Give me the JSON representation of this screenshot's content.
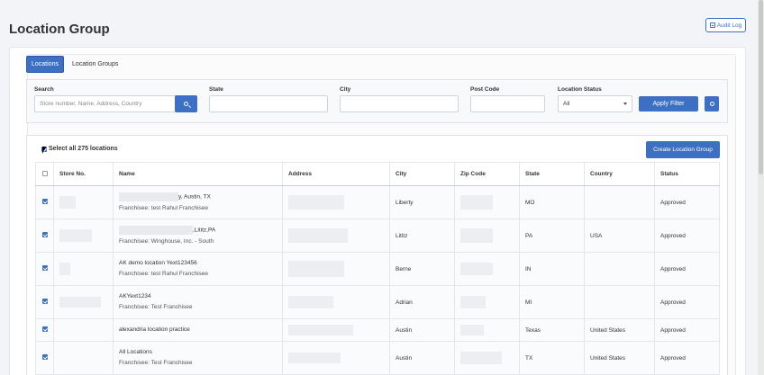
{
  "page": {
    "title": "Location Group",
    "audit_log_label": "Audit Log"
  },
  "tabs": [
    {
      "label": "Locations",
      "active": true
    },
    {
      "label": "Location Groups",
      "active": false
    }
  ],
  "filters": {
    "search_label": "Search",
    "search_placeholder": "Store number, Name, Address, Country",
    "state_label": "State",
    "city_label": "City",
    "postcode_label": "Post Code",
    "status_label": "Location Status",
    "status_value": "All",
    "apply_label": "Apply Filter"
  },
  "list": {
    "select_all_label": "Select all 275 locations",
    "create_group_label": "Create Location Group",
    "columns": [
      "Store No.",
      "Name",
      "Address",
      "City",
      "Zip Code",
      "State",
      "Country",
      "Status"
    ],
    "rows": [
      {
        "name": "y, Austin, TX",
        "franchisee": "Franchisee: test Rahul Franchisee",
        "city": "Liberty",
        "state": "MO",
        "country": "",
        "status": "Approved"
      },
      {
        "name": ",Lititz,PA",
        "franchisee": "Franchisee: Winghouse, Inc. - South",
        "city": "Lititz",
        "state": "PA",
        "country": "USA",
        "status": "Approved"
      },
      {
        "name": "AK demo location Yext123456",
        "franchisee": "Franchisee: test Rahul Franchisee",
        "city": "Berne",
        "state": "IN",
        "country": "",
        "status": "Approved"
      },
      {
        "name": "AKYext1234",
        "franchisee": "Franchisee: Test Franchisee",
        "city": "Adrian",
        "state": "MI",
        "country": "",
        "status": "Approved"
      },
      {
        "name": "alexandria location practice",
        "franchisee": "",
        "city": "Austin",
        "state": "Texas",
        "country": "United States",
        "status": "Approved"
      },
      {
        "name": "All Locations",
        "franchisee": "Franchisee: Test Franchisee",
        "city": "Austin",
        "state": "TX",
        "country": "United States",
        "status": "Approved"
      }
    ]
  },
  "colors": {
    "accent": "#3d6fc2",
    "background": "#f3f4f7"
  },
  "icons": [
    "audit-log-icon",
    "search-icon",
    "gear-icon",
    "checkbox-icon",
    "dropdown-caret-icon",
    "mouse-cursor-icon"
  ]
}
